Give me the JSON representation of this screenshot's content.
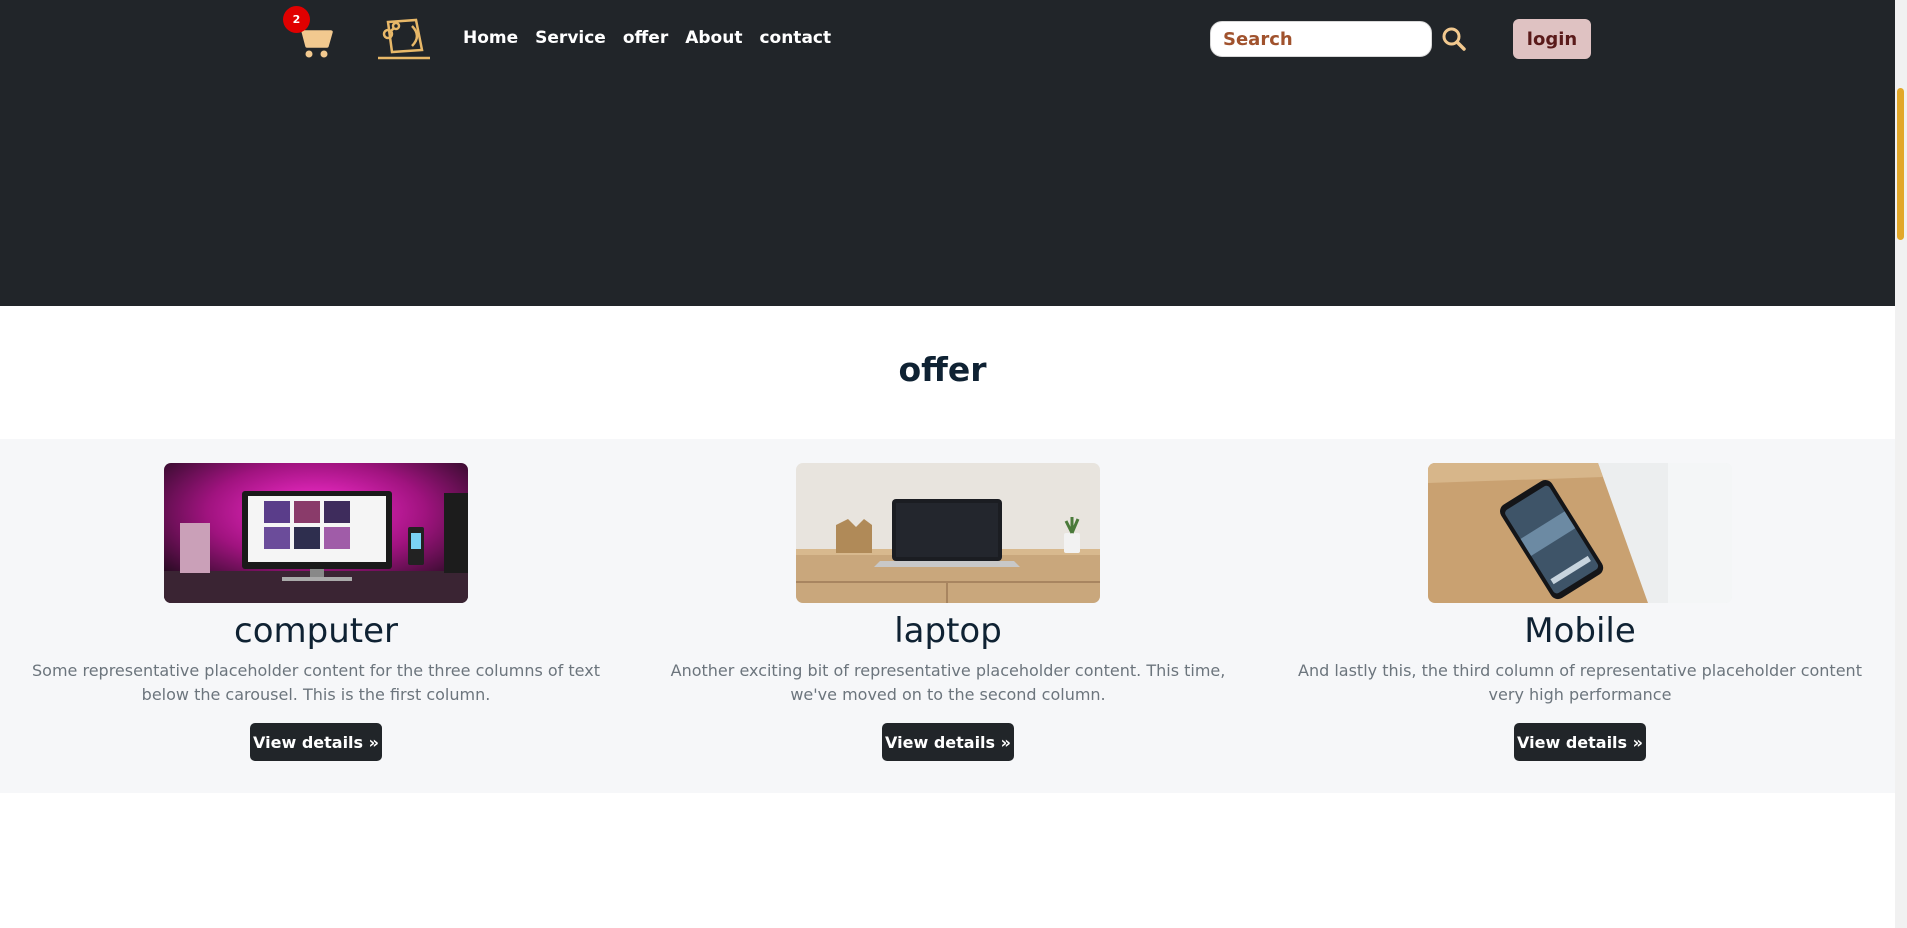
{
  "header": {
    "cart_count": "2",
    "nav": [
      "Home",
      "Service",
      "offer",
      "About",
      "contact"
    ],
    "search_placeholder": "Search",
    "login_label": "login"
  },
  "section": {
    "title": "offer"
  },
  "cards": [
    {
      "title": "computer",
      "text": "Some representative placeholder content for the three columns of text below the carousel. This is the first column.",
      "button": "View details »"
    },
    {
      "title": "laptop",
      "text": "Another exciting bit of representative placeholder content. This time, we've moved on to the second column.",
      "button": "View details »"
    },
    {
      "title": "Mobile",
      "text": "And lastly this, the third column of representative placeholder content very high performance",
      "button": "View details »"
    }
  ],
  "colors": {
    "header_bg": "#212529",
    "accent": "#e2a82a",
    "badge": "#e00000",
    "login_bg": "#dfc2c2"
  },
  "icons": [
    "cart-icon",
    "laptop-logo-icon",
    "search-icon"
  ]
}
